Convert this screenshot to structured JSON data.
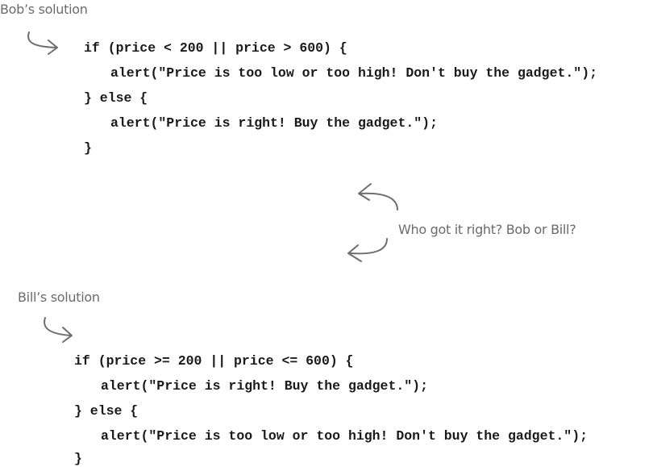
{
  "bob": {
    "caption": "Bob’s solution",
    "code": [
      "if (price < 200 || price > 600) {",
      "alert(\"Price is too low or too high! Don't buy the gadget.\");",
      "} else {",
      "alert(\"Price is right! Buy the gadget.\");",
      "}"
    ]
  },
  "question": "Who got it right? Bob or Bill?",
  "bill": {
    "caption": "Bill’s solution",
    "code": [
      "if (price >= 200 || price <= 600) {",
      "alert(\"Price is right! Buy the gadget.\");",
      "} else {",
      "alert(\"Price is too low or too high! Don't buy the gadget.\");",
      "}"
    ]
  }
}
